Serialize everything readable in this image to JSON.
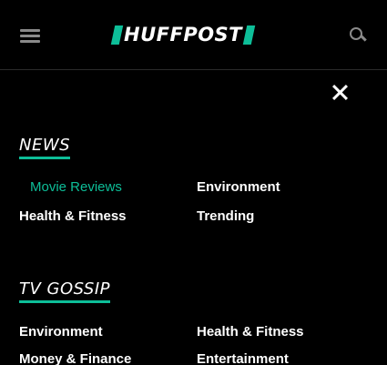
{
  "header": {
    "logo_text": "HUFFPOST",
    "menu_icon": "hamburger-menu-icon",
    "search_icon": "search-icon"
  },
  "overlay": {
    "close_icon": "close-icon"
  },
  "colors": {
    "background": "#000000",
    "accent": "#0dbe98",
    "text": "#ffffff",
    "icon_gray": "#8a8a8a"
  },
  "sections": {
    "news": {
      "title": "NEWS",
      "links": [
        "Movie Reviews",
        "Environment",
        "Health & Fitness",
        "Trending"
      ],
      "active_link": "Movie Reviews"
    },
    "tv_gossip": {
      "title": "TV GOSSIP",
      "links": [
        "Environment",
        "Health & Fitness",
        "Money & Finance",
        "Entertainment"
      ]
    }
  }
}
